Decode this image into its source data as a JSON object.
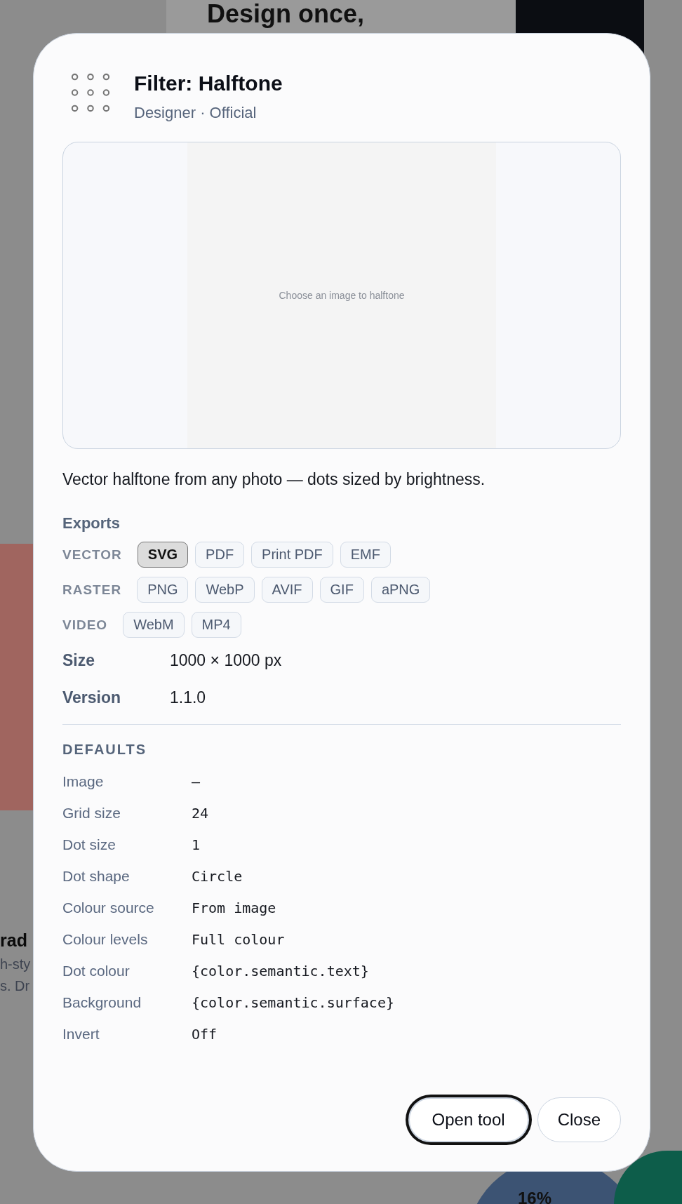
{
  "background": {
    "hero_title": [
      "Design once,"
    ],
    "card_texts": [
      "rad",
      "h-sty",
      "s. Dr"
    ],
    "chart_label": "16%"
  },
  "dialog": {
    "title": "Filter: Halftone",
    "subtitle": "Designer · Official",
    "preview": {
      "prompt": "Choose an image to halftone"
    },
    "description": "Vector halftone from any photo — dots sized by brightness.",
    "exports": {
      "heading": "Exports",
      "groups": [
        {
          "label": "VECTOR",
          "formats": [
            {
              "label": "SVG",
              "selected": true
            },
            {
              "label": "PDF",
              "selected": false
            },
            {
              "label": "Print PDF",
              "selected": false
            },
            {
              "label": "EMF",
              "selected": false
            }
          ]
        },
        {
          "label": "RASTER",
          "formats": [
            {
              "label": "PNG",
              "selected": false
            },
            {
              "label": "WebP",
              "selected": false
            },
            {
              "label": "AVIF",
              "selected": false
            },
            {
              "label": "GIF",
              "selected": false
            },
            {
              "label": "aPNG",
              "selected": false
            }
          ]
        },
        {
          "label": "VIDEO",
          "formats": [
            {
              "label": "WebM",
              "selected": false
            },
            {
              "label": "MP4",
              "selected": false
            }
          ]
        }
      ]
    },
    "specs": [
      {
        "label": "Size",
        "value": "1000 × 1000 px"
      },
      {
        "label": "Version",
        "value": "1.1.0"
      }
    ],
    "defaults": {
      "heading": "DEFAULTS",
      "rows": [
        {
          "label": "Image",
          "value": "—"
        },
        {
          "label": "Grid size",
          "value": "24"
        },
        {
          "label": "Dot size",
          "value": "1"
        },
        {
          "label": "Dot shape",
          "value": "Circle"
        },
        {
          "label": "Colour source",
          "value": "From image"
        },
        {
          "label": "Colour levels",
          "value": "Full colour"
        },
        {
          "label": "Dot colour",
          "value": "{color.semantic.text}"
        },
        {
          "label": "Background",
          "value": "{color.semantic.surface}"
        },
        {
          "label": "Invert",
          "value": "Off"
        }
      ]
    },
    "buttons": [
      {
        "label": "Open tool",
        "focused": true
      },
      {
        "label": "Close",
        "focused": false
      }
    ]
  }
}
